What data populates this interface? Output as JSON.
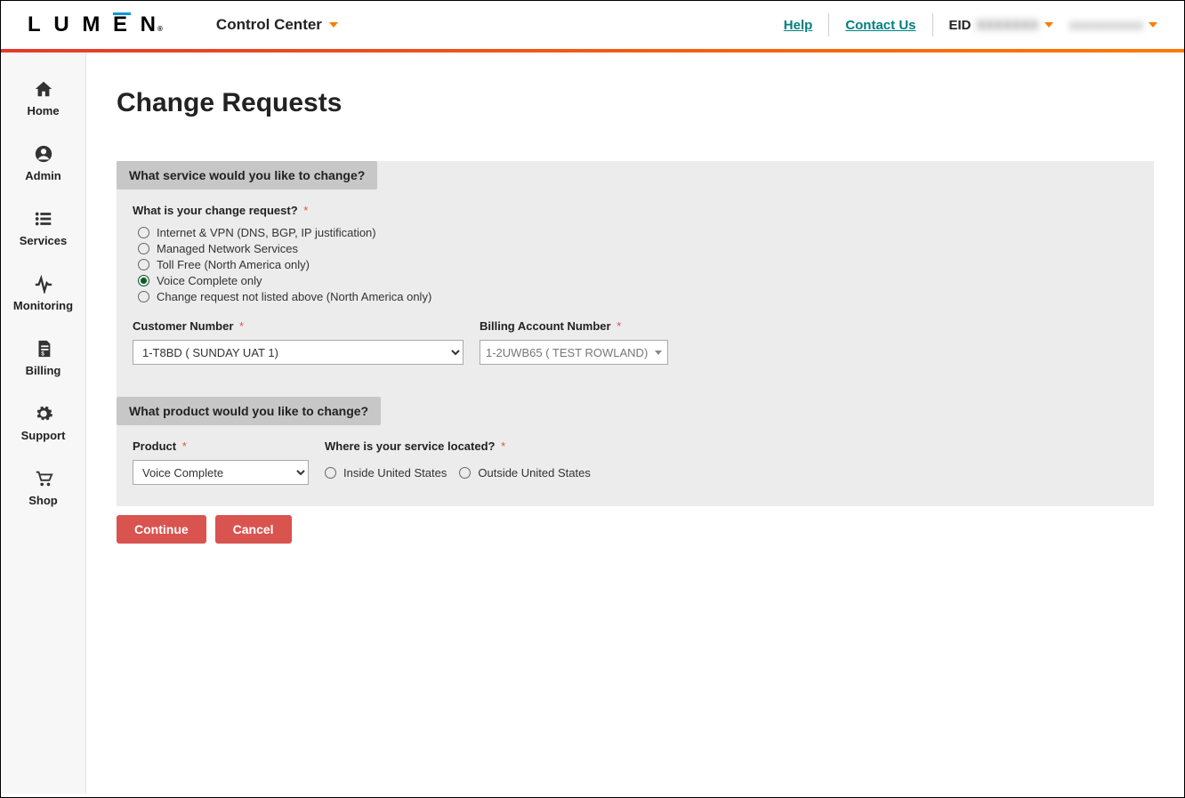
{
  "header": {
    "logo_text": "LUMEN",
    "logo_sup": "®",
    "control_center": "Control Center",
    "help": "Help",
    "contact": "Contact Us",
    "eid_label": "EID",
    "eid_value": "XXXXXXX",
    "user_value": "xxxxxxxxxx"
  },
  "sidebar": {
    "items": [
      {
        "label": "Home",
        "icon": "home"
      },
      {
        "label": "Admin",
        "icon": "user"
      },
      {
        "label": "Services",
        "icon": "list"
      },
      {
        "label": "Monitoring",
        "icon": "activity"
      },
      {
        "label": "Billing",
        "icon": "billing"
      },
      {
        "label": "Support",
        "icon": "gear"
      },
      {
        "label": "Shop",
        "icon": "cart"
      }
    ]
  },
  "page": {
    "title": "Change Requests"
  },
  "form": {
    "section1": {
      "heading": "What service would you like to change?",
      "question_label": "What is your change request?",
      "radios": [
        {
          "label": "Internet & VPN (DNS, BGP, IP justification)",
          "checked": false
        },
        {
          "label": "Managed Network Services",
          "checked": false
        },
        {
          "label": "Toll Free (North America only)",
          "checked": false
        },
        {
          "label": "Voice Complete only",
          "checked": true
        },
        {
          "label": "Change request not listed above (North America only)",
          "checked": false
        }
      ],
      "customer_number_label": "Customer Number",
      "customer_number_value": "1-T8BD ( SUNDAY UAT 1)",
      "billing_account_label": "Billing Account Number",
      "billing_account_value": "1-2UWB65 ( TEST ROWLAND)"
    },
    "section2": {
      "heading": "What product would you like to change?",
      "product_label": "Product",
      "product_value": "Voice Complete",
      "location_label": "Where is your service located?",
      "location_options": [
        {
          "label": "Inside United States",
          "checked": false
        },
        {
          "label": "Outside United States",
          "checked": false
        }
      ]
    },
    "buttons": {
      "continue": "Continue",
      "cancel": "Cancel"
    }
  }
}
